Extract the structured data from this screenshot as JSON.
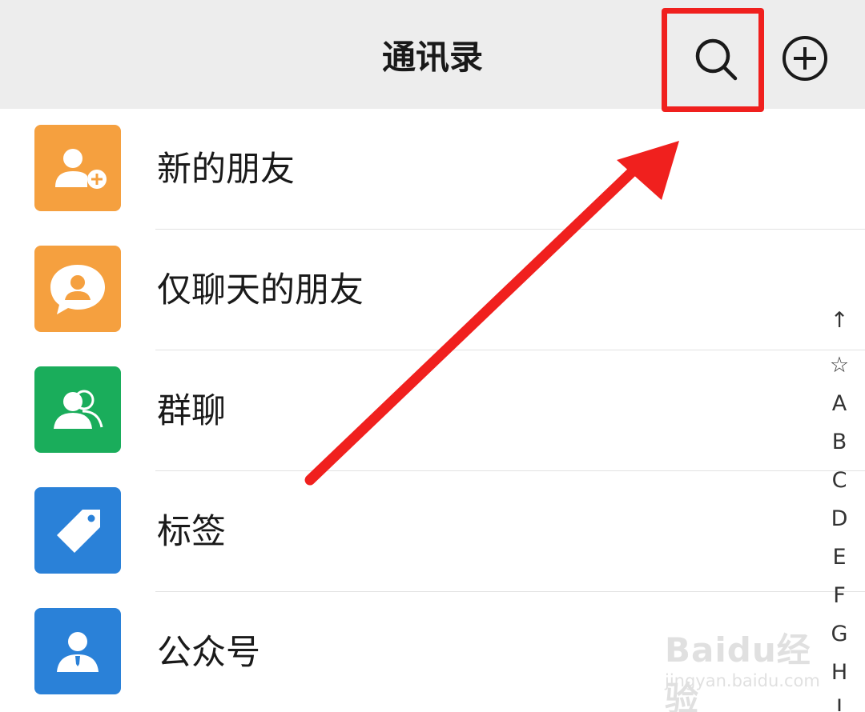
{
  "header": {
    "title": "通讯录",
    "background_color": "#ededed",
    "search_icon": "search-icon",
    "add_icon": "add-circle-icon"
  },
  "highlight": {
    "color": "#f0201e"
  },
  "contacts_menu": [
    {
      "label": "新的朋友",
      "icon": "add-friend-icon",
      "color": "#f5a03f"
    },
    {
      "label": "仅聊天的朋友",
      "icon": "chat-bubble-person-icon",
      "color": "#f5a03f"
    },
    {
      "label": "群聊",
      "icon": "group-icon",
      "color": "#1aad5b"
    },
    {
      "label": "标签",
      "icon": "tag-icon",
      "color": "#2a81d8"
    },
    {
      "label": "公众号",
      "icon": "official-account-icon",
      "color": "#2a81d8"
    }
  ],
  "index_bar": [
    "↑",
    "☆",
    "A",
    "B",
    "C",
    "D",
    "E",
    "F",
    "G",
    "H",
    "I"
  ],
  "watermark": {
    "brand": "Baidu经验",
    "url": "jingyan.baidu.com"
  }
}
